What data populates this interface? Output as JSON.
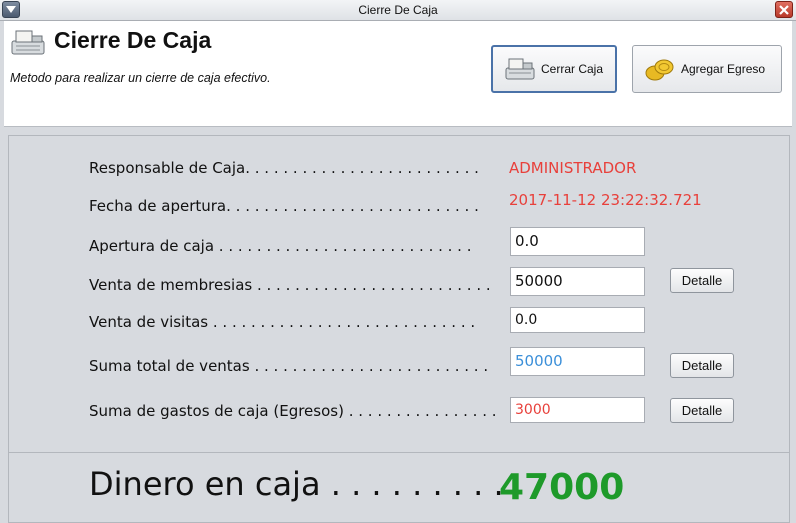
{
  "window": {
    "title": "Cierre De Caja"
  },
  "header": {
    "heading": "Cierre De Caja",
    "subtitle": "Metodo para realizar un cierre de caja efectivo.",
    "buttons": {
      "cerrar_caja": "Cerrar Caja",
      "agregar_egreso": "Agregar Egreso"
    }
  },
  "form": {
    "responsable_label": "Responsable de Caja. . . . . . . . . . . . . . . . . . . . . . . . .",
    "responsable_value": "ADMINISTRADOR",
    "fecha_label": "Fecha de apertura. . . . . . . . . . . . . . . . . . . . . . . . . . .",
    "fecha_value": "2017-11-12 23:22:32.721",
    "apertura_label": "Apertura de caja . . . . . . . . . . . . . . . . . . . . . . . . . . .",
    "apertura_value": "0.0",
    "membresias_label": "Venta de membresias . . . . . . . . . . . . . . . . . . . . . . . . .",
    "membresias_value": "50000",
    "visitas_label": "Venta de visitas . . . . . . . . . . . . . . . . . . . . . . . . . . . .",
    "visitas_value": "0.0",
    "suma_ventas_label": "Suma total de ventas . . . . . . . . . . . . . . . . . . . . . . . . .",
    "suma_ventas_value": "50000",
    "gastos_label": "Suma de gastos de caja (Egresos) . . . . . . . . . . . . . . . .",
    "gastos_value": "3000",
    "detalle_label": "Detalle"
  },
  "total": {
    "label": "Dinero en caja . . . . . . . . .",
    "value": "47000"
  },
  "colors": {
    "red": "#e8403b",
    "blue": "#3b8fd9",
    "green": "#1e9a2a"
  }
}
